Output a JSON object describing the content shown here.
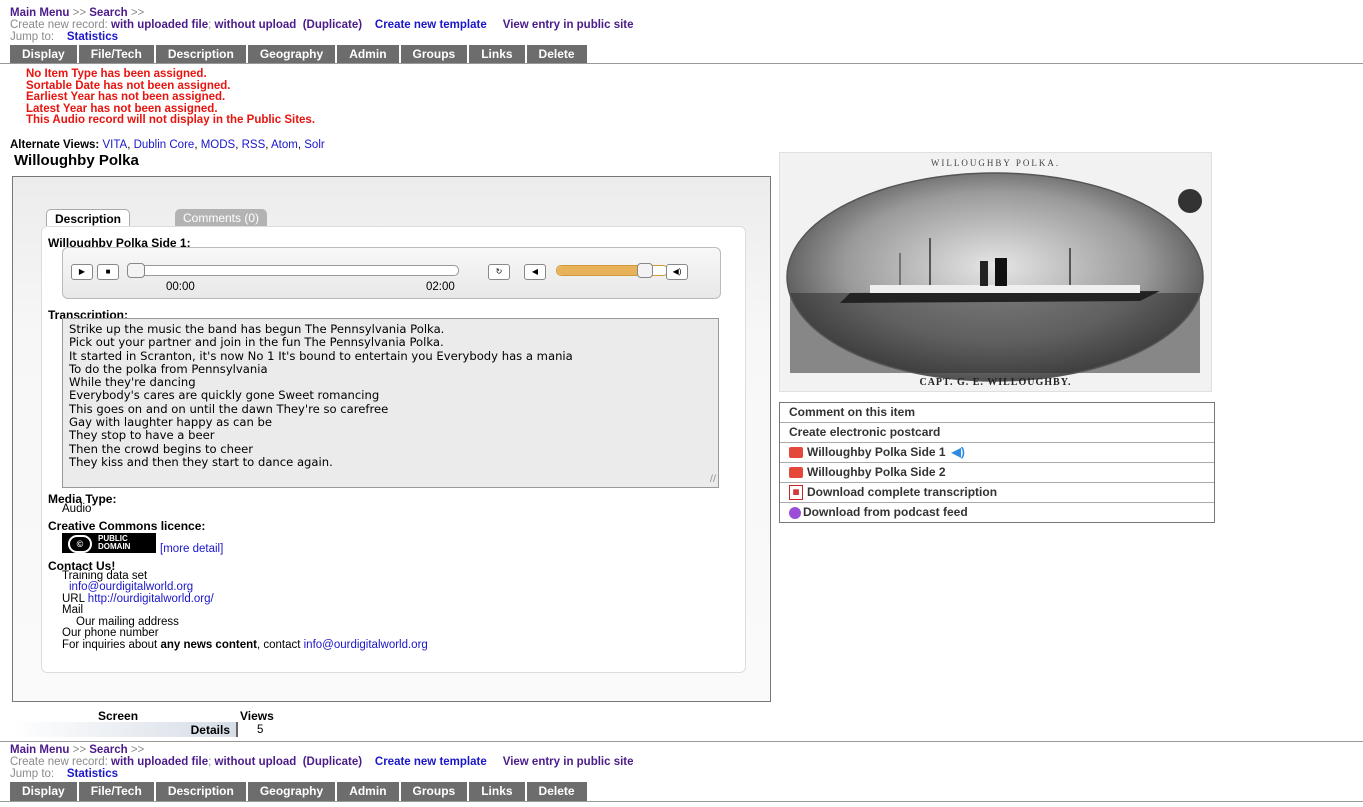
{
  "nav": {
    "main_menu": "Main Menu",
    "sep1": ">>",
    "search": "Search",
    "sep2": ">>",
    "create_new_record": "Create new record:",
    "with_uploaded_file": "with uploaded file",
    "semicolon": ";",
    "without_upload": "without upload",
    "duplicate": "(Duplicate)",
    "create_new_template": "Create new template",
    "view_entry": "View entry in public site",
    "jump_to": "Jump to:",
    "statistics": "Statistics"
  },
  "tabs": [
    "Display",
    "File/Tech",
    "Description",
    "Geography",
    "Admin",
    "Groups",
    "Links",
    "Delete"
  ],
  "errors": [
    "No Item Type has been assigned.",
    "Sortable Date has not been assigned.",
    "Earliest Year has not been assigned.",
    "Latest Year has not been assigned.",
    "This Audio record will not display in the Public Sites."
  ],
  "alt_views": {
    "label": "Alternate Views:",
    "items": [
      "VITA",
      "Dublin Core",
      "MODS",
      "RSS",
      "Atom",
      "Solr"
    ]
  },
  "record_title": "Willoughby Polka",
  "panel": {
    "tab_description": "Description",
    "tab_comments": "Comments (0)",
    "audio_title": "Willoughby Polka Side 1:",
    "player": {
      "current": "00:00",
      "duration": "02:00",
      "progress": 0.0,
      "volume": 0.8
    },
    "transcription_label": "Transcription:",
    "transcription": [
      "Strike up the music the band has begun The Pennsylvania Polka.",
      "Pick out your partner and join in the fun The Pennsylvania Polka.",
      "It started in Scranton, it's now No 1 It's bound to entertain you Everybody has a mania",
      "To do the polka from Pennsylvania",
      "While they're dancing",
      "Everybody's cares are quickly gone Sweet romancing",
      "This goes on and on until the dawn They're so carefree",
      "Gay with laughter happy as can be",
      "They stop to have a beer",
      "Then the crowd begins to cheer",
      "They kiss and then they start to dance again."
    ],
    "media_type_label": "Media Type:",
    "media_type": "Audio",
    "cc_label": "Creative Commons licence:",
    "cc_badge": "PUBLIC DOMAIN",
    "more_detail": "[more detail]",
    "contact_label": "Contact Us!",
    "contact_line1": "Training data set",
    "contact_email": "info@ourdigitalworld.org",
    "url_label": "URL",
    "url": "http://ourdigitalworld.org/",
    "mail_label": "Mail",
    "mail_address": "Our mailing address",
    "phone": "Our phone number",
    "inquiries_pre": "For inquiries about ",
    "inquiries_bold": "any news content",
    "inquiries_post": ", contact ",
    "inquiries_email": "info@ourdigitalworld.org"
  },
  "stats": {
    "col1": "Screen",
    "col2": "Views",
    "row_label": "Details",
    "row_value": "5"
  },
  "image": {
    "caption_top": "WILLOUGHBY POLKA.",
    "caption_bottom": "CAPT. G. E. WILLOUGHBY."
  },
  "side_actions": [
    {
      "label": "Comment on this item",
      "icon": ""
    },
    {
      "label": "Create electronic postcard",
      "icon": ""
    },
    {
      "label": "Willoughby Polka Side 1",
      "icon": "audio-file-icon"
    },
    {
      "label": "Willoughby Polka Side 2",
      "icon": "audio-file-icon"
    },
    {
      "label": "Download complete transcription",
      "icon": "pdf-icon"
    },
    {
      "label": "Download from podcast feed",
      "icon": "podcast-icon"
    }
  ],
  "colors": {
    "tab_bg": "#6d6d6d",
    "error": "#e8140f",
    "link": "#1a16c9",
    "volume": "#e8b25a"
  }
}
